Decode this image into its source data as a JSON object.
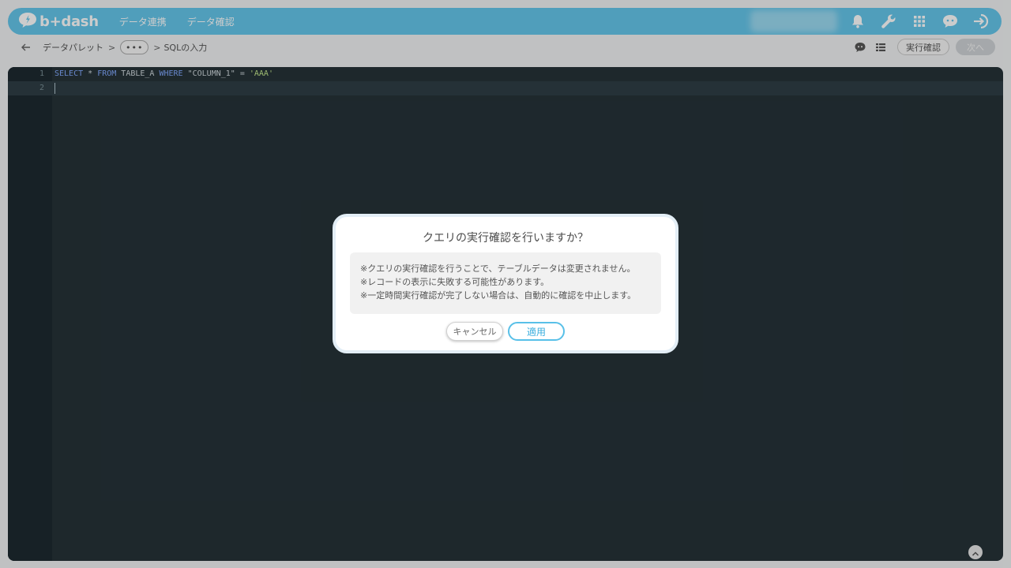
{
  "header": {
    "logo_text": "b+dash",
    "nav": [
      "データ連携",
      "データ確認"
    ],
    "icons": [
      "bell-icon",
      "wrench-icon",
      "grid-icon",
      "chat-bot-icon",
      "logout-icon"
    ],
    "accent_color": "#65c6ea"
  },
  "breadcrumb": {
    "items": [
      "データパレット",
      "•••",
      "SQLの入力"
    ],
    "separator": ">"
  },
  "toolbar": {
    "run_confirm_label": "実行確認",
    "next_label": "次へ"
  },
  "editor": {
    "lines": [
      {
        "number": "1",
        "tokens": [
          {
            "t": "SELECT",
            "c": "kw"
          },
          {
            "t": " * ",
            "c": "plain"
          },
          {
            "t": "FROM",
            "c": "kw"
          },
          {
            "t": " TABLE_A ",
            "c": "plain"
          },
          {
            "t": "WHERE",
            "c": "kw"
          },
          {
            "t": " \"COLUMN_1\" = ",
            "c": "plain"
          },
          {
            "t": "'AAA'",
            "c": "str"
          }
        ]
      },
      {
        "number": "2",
        "tokens": []
      }
    ]
  },
  "modal": {
    "title": "クエリの実行確認を行いますか？",
    "notes": [
      "※クエリの実行確認を行うことで、テーブルデータは変更されません。",
      "※レコードの表示に失敗する可能性があります。",
      "※一定時間実行確認が完了しない場合は、自動的に確認を中止します。"
    ],
    "cancel_label": "キャンセル",
    "apply_label": "適用"
  }
}
